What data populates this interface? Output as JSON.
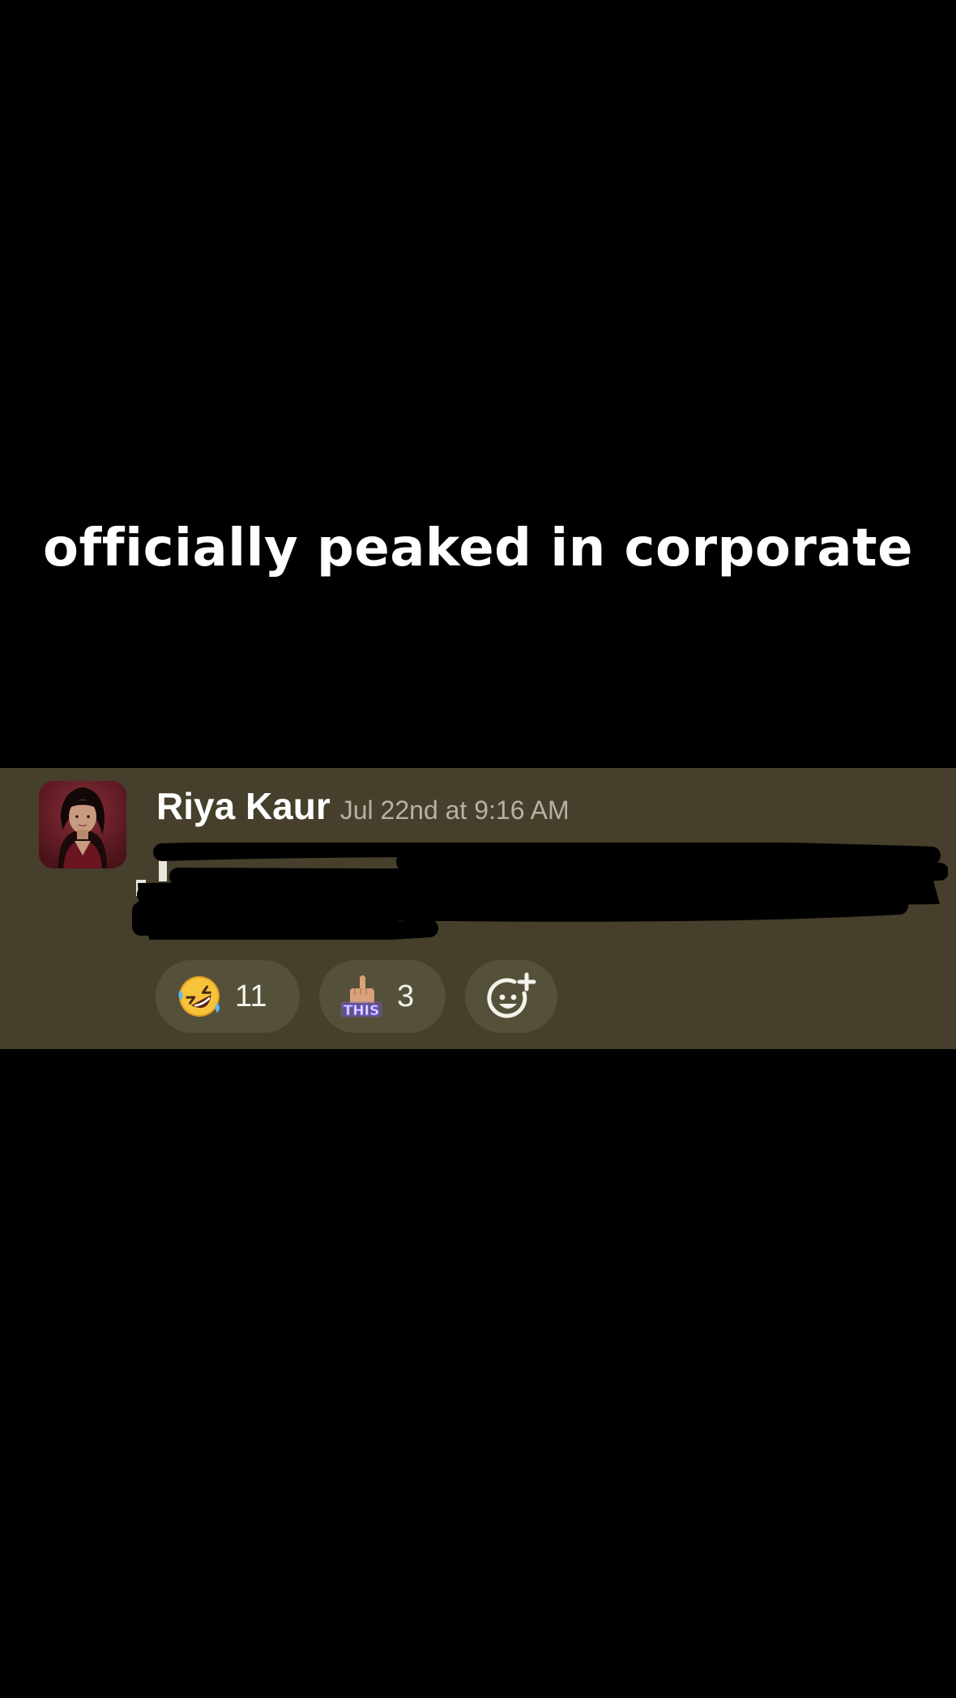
{
  "caption": {
    "text": "officially peaked in corporate"
  },
  "message": {
    "author": "Riya Kaur",
    "timestamp": "Jul 22nd at 9:16 AM",
    "body_state": "redacted-scribble",
    "avatar_icon": "profile-photo"
  },
  "reactions": [
    {
      "icon": "rolling-on-floor-laughing-emoji",
      "count": "11"
    },
    {
      "icon": "this-pointing-up-emoji",
      "count": "3"
    }
  ],
  "add_reaction": {
    "icon": "add-reaction-icon"
  },
  "colors": {
    "background": "#000000",
    "card_background": "#463f2b",
    "pill_background": "#555039",
    "timestamp_gray": "#b5b1a4",
    "text_white": "#ffffff"
  }
}
